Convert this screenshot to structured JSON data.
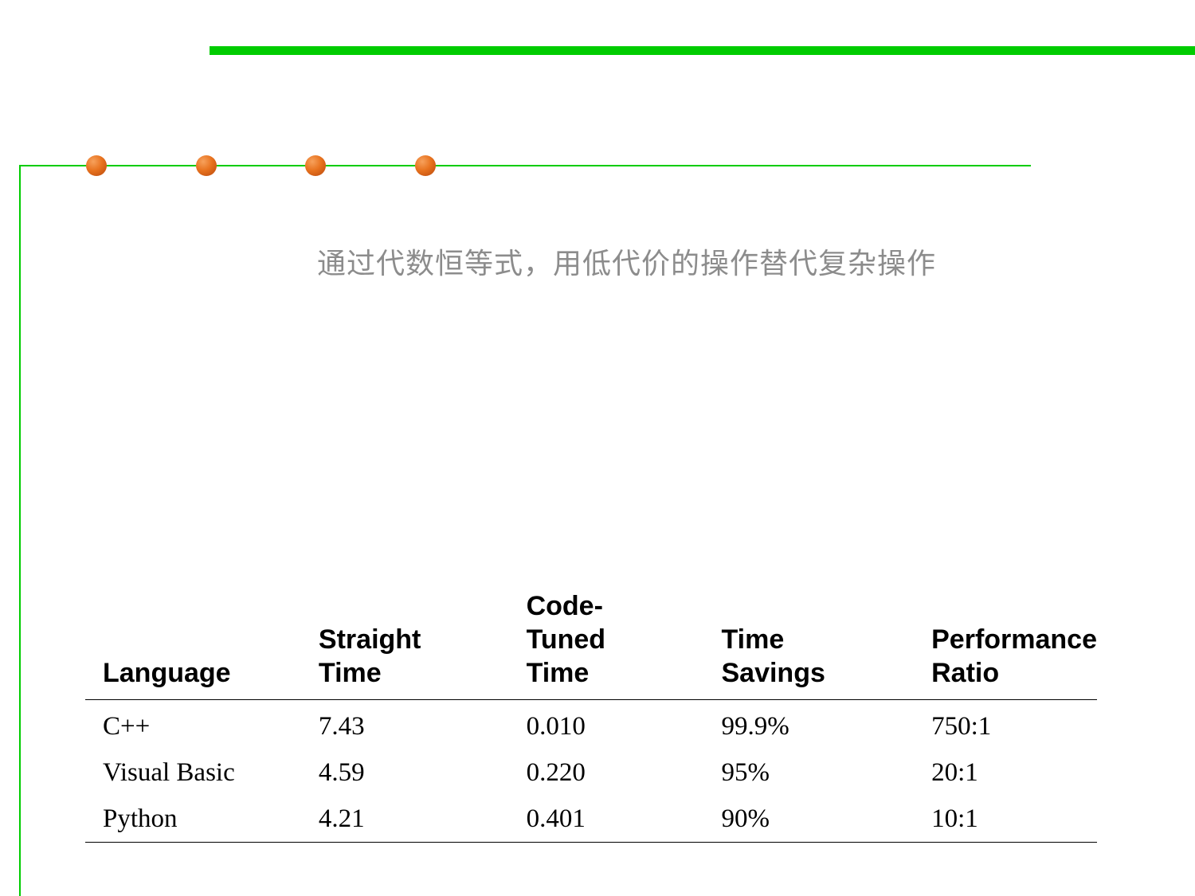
{
  "decor": {
    "accent_green": "#00cc00",
    "dot_orange": "#e8731f",
    "dot_count": 4
  },
  "subtitle": "通过代数恒等式，用低代价的操作替代复杂操作",
  "table": {
    "headers": {
      "language": "Language",
      "straight_time": "Straight\nTime",
      "tuned_time": "Code-\nTuned\nTime",
      "time_savings": "Time\nSavings",
      "performance_ratio": "Performance\nRatio"
    },
    "rows": [
      {
        "language": "C++",
        "straight_time": "7.43",
        "tuned_time": "0.010",
        "time_savings": "99.9%",
        "performance_ratio": "750:1"
      },
      {
        "language": "Visual Basic",
        "straight_time": "4.59",
        "tuned_time": "0.220",
        "time_savings": "95%",
        "performance_ratio": "20:1"
      },
      {
        "language": "Python",
        "straight_time": "4.21",
        "tuned_time": "0.401",
        "time_savings": "90%",
        "performance_ratio": "10:1"
      }
    ]
  }
}
